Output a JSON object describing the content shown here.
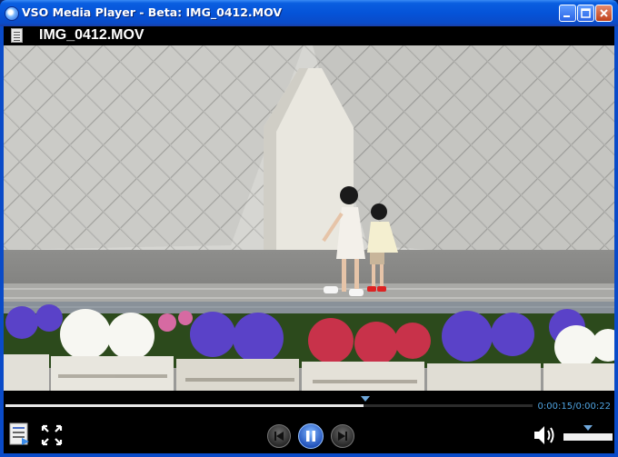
{
  "window": {
    "title": "VSO Media Player - Beta: IMG_0412.MOV",
    "buttons": {
      "minimize": "minimize-icon",
      "maximize": "maximize-icon",
      "close": "close-icon"
    }
  },
  "header": {
    "file_name": "IMG_0412.MOV",
    "icon": "document-icon"
  },
  "player": {
    "time_display": "0:00:15/0:00:22",
    "progress_fraction": 0.68,
    "volume_fraction": 0.6,
    "icons": {
      "playlist": "playlist-icon",
      "fullscreen": "fullscreen-icon",
      "previous": "previous-icon",
      "pause": "pause-icon",
      "next": "next-icon",
      "volume": "speaker-icon"
    }
  },
  "colors": {
    "titlebar": "#0553d8",
    "accent": "#4fa3e0",
    "background": "#000000"
  }
}
